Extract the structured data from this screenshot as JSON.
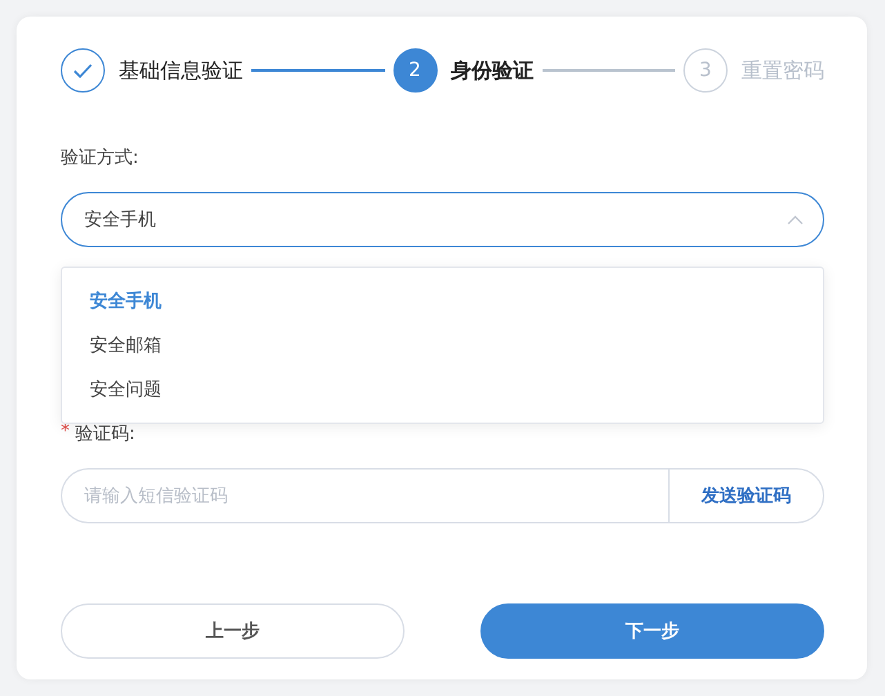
{
  "steps": [
    {
      "label": "基础信息验证",
      "completed": true,
      "selected": false
    },
    {
      "number": "2",
      "label": "身份验证",
      "completed": false,
      "selected": true
    },
    {
      "number": "3",
      "label": "重置密码",
      "completed": false,
      "selected": false
    }
  ],
  "method": {
    "label": "验证方式:",
    "value": "安全手机",
    "expanded": true,
    "options": [
      {
        "label": "安全手机",
        "selected": true
      },
      {
        "label": "安全邮箱",
        "selected": false
      },
      {
        "label": "安全问题",
        "selected": false
      }
    ]
  },
  "code": {
    "marker": "*",
    "label": "验证码:",
    "placeholder": "请输入短信验证码",
    "send_button": "发送验证码"
  },
  "buttons": {
    "prev": "上一步",
    "next": "下一步"
  }
}
